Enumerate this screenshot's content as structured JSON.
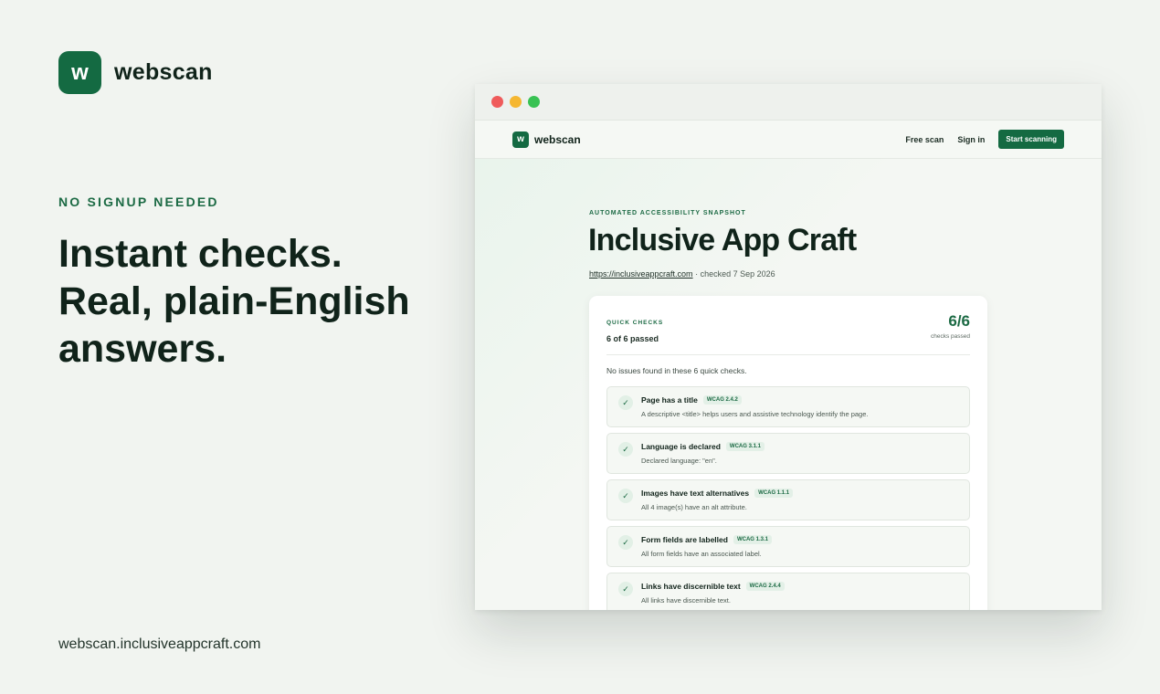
{
  "brand": {
    "logo_letter": "w",
    "name": "webscan"
  },
  "hero": {
    "eyebrow": "NO SIGNUP NEEDED",
    "headline": "Instant checks. Real, plain-English answers.",
    "footer_url": "webscan.inclusiveappcraft.com"
  },
  "browser": {
    "nav": {
      "free_scan": "Free scan",
      "sign_in": "Sign in",
      "cta": "Start scanning"
    },
    "snapshot": {
      "eyebrow": "AUTOMATED ACCESSIBILITY SNAPSHOT",
      "title": "Inclusive App Craft",
      "url": "https://inclusiveappcraft.com",
      "checked": "· checked 7 Sep 2026"
    },
    "card": {
      "eyebrow": "QUICK CHECKS",
      "passed_summary": "6 of 6 passed",
      "score": "6/6",
      "score_label": "checks passed",
      "notice": "No issues found in these 6 quick checks.",
      "checks": [
        {
          "title": "Page has a title",
          "wcag": "WCAG 2.4.2",
          "desc": "A descriptive <title> helps users and assistive technology identify the page."
        },
        {
          "title": "Language is declared",
          "wcag": "WCAG 3.1.1",
          "desc": "Declared language: \"en\"."
        },
        {
          "title": "Images have text alternatives",
          "wcag": "WCAG 1.1.1",
          "desc": "All 4 image(s) have an alt attribute."
        },
        {
          "title": "Form fields are labelled",
          "wcag": "WCAG 1.3.1",
          "desc": "All form fields have an associated label."
        },
        {
          "title": "Links have discernible text",
          "wcag": "WCAG 2.4.4",
          "desc": "All links have discernible text."
        }
      ]
    }
  },
  "icons": {
    "check": "✓"
  },
  "colors": {
    "brand_green": "#146a42",
    "accent_green": "#1c6a44"
  }
}
